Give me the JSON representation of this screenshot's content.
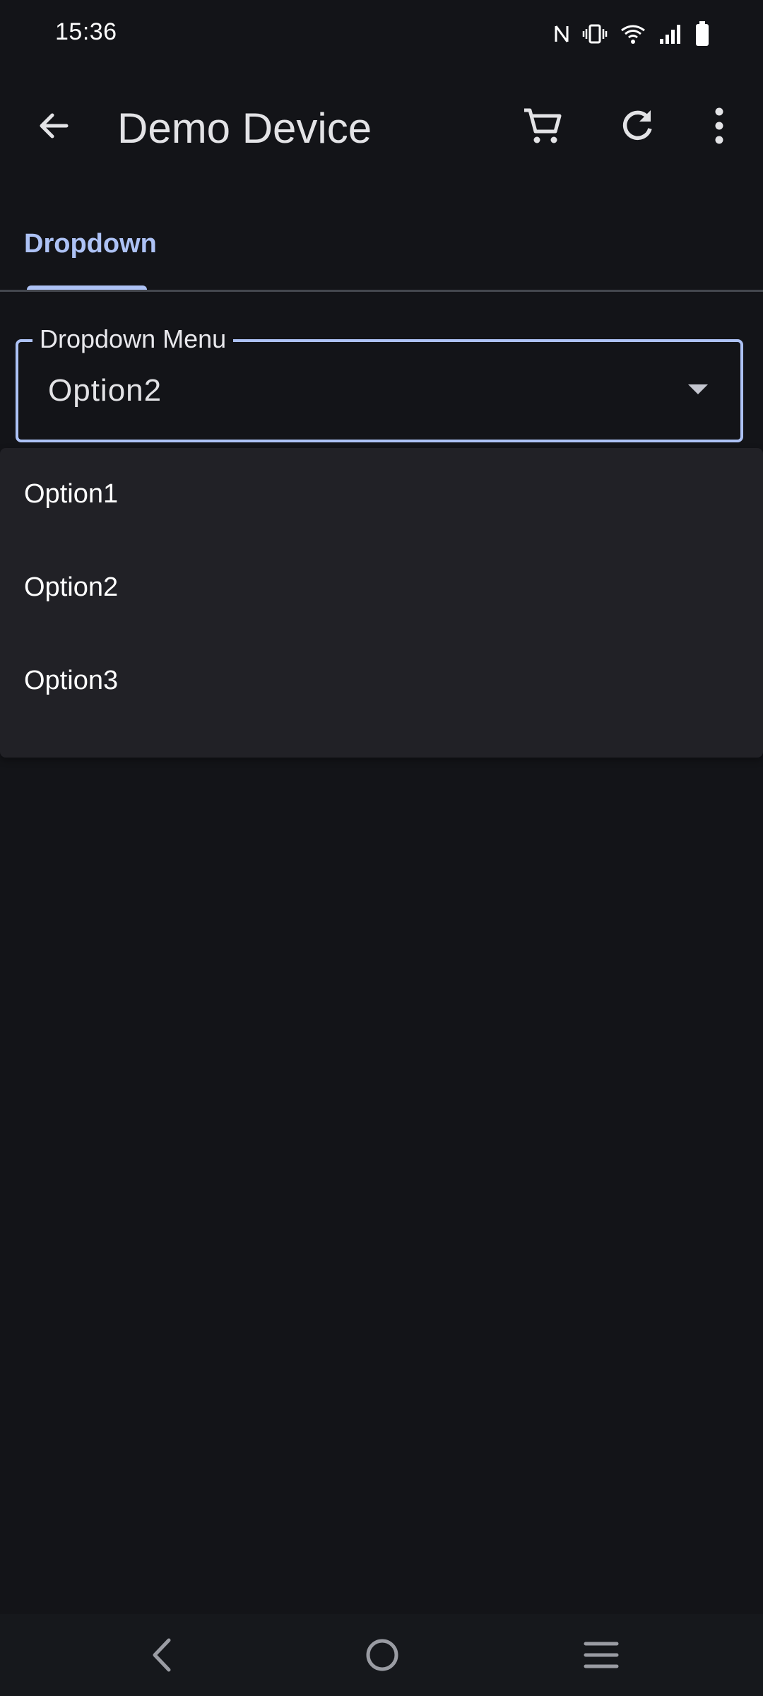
{
  "status_bar": {
    "time": "15:36",
    "icons": [
      "nfc-icon",
      "vibrate-icon",
      "wifi-icon",
      "cell-signal-icon",
      "battery-icon"
    ]
  },
  "app_bar": {
    "title": "Demo Device",
    "back_icon": "arrow-left-icon",
    "actions": [
      "cart-icon",
      "refresh-icon",
      "more-vert-icon"
    ]
  },
  "tabs": [
    {
      "label": "Dropdown",
      "selected": true
    }
  ],
  "dropdown": {
    "label": "Dropdown Menu",
    "value": "Option2",
    "options": [
      "Option1",
      "Option2",
      "Option3"
    ]
  },
  "colors": {
    "background": "#131418",
    "accent": "#adc2f5",
    "menu_background": "#212126",
    "text_primary": "#e3e3e6"
  },
  "nav_bar": {
    "buttons": [
      "nav-back-icon",
      "nav-home-icon",
      "nav-recents-icon"
    ]
  }
}
